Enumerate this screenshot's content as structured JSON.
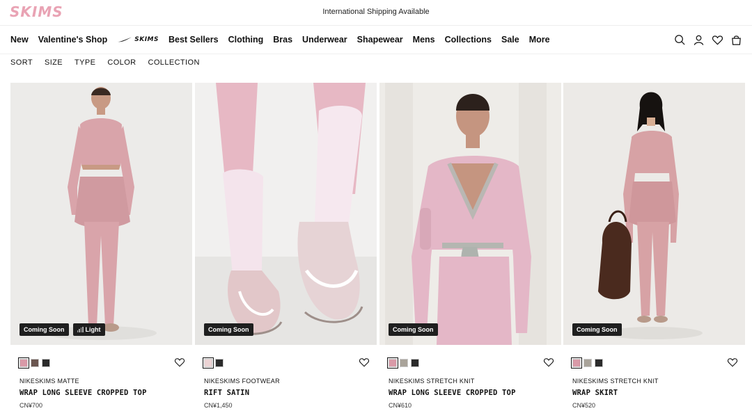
{
  "header": {
    "logo": "SKIMS",
    "shipping_notice": "International Shipping Available"
  },
  "nav": {
    "items": [
      "New",
      "Valentine's Shop"
    ],
    "collab_logo": "SKIMS",
    "items_after": [
      "Best Sellers",
      "Clothing",
      "Bras",
      "Underwear",
      "Shapewear",
      "Mens",
      "Collections",
      "Sale",
      "More"
    ],
    "icons": [
      "search-icon",
      "account-icon",
      "wishlist-icon",
      "bag-icon"
    ]
  },
  "filters": [
    "SORT",
    "SIZE",
    "TYPE",
    "COLOR",
    "COLLECTION"
  ],
  "products": [
    {
      "badges": [
        "Coming Soon",
        "Light"
      ],
      "swatches": [
        "#d99aa8",
        "#6b5650",
        "#2b2b2b"
      ],
      "brand": "NIKESKIMS MATTE",
      "title": "WRAP LONG SLEEVE CROPPED TOP",
      "price": "CN¥700"
    },
    {
      "badges": [
        "Coming Soon"
      ],
      "swatches": [
        "#ecd3d4",
        "#2b2b2b"
      ],
      "brand": "NIKESKIMS FOOTWEAR",
      "title": "RIFT SATIN",
      "price": "CN¥1,450"
    },
    {
      "badges": [
        "Coming Soon"
      ],
      "swatches": [
        "#d99aa8",
        "#a9a39a",
        "#2b2b2b"
      ],
      "brand": "NIKESKIMS STRETCH KNIT",
      "title": "WRAP LONG SLEEVE CROPPED TOP",
      "price": "CN¥610"
    },
    {
      "badges": [
        "Coming Soon"
      ],
      "swatches": [
        "#d99aa8",
        "#a9a39a",
        "#2b2b2b"
      ],
      "brand": "NIKESKIMS STRETCH KNIT",
      "title": "WRAP SKIRT",
      "price": "CN¥520"
    }
  ],
  "colors": {
    "logo_pink": "#e9a3b4",
    "badge_bg": "#1f1f1f",
    "garment_pink": "#d9a4aa"
  }
}
